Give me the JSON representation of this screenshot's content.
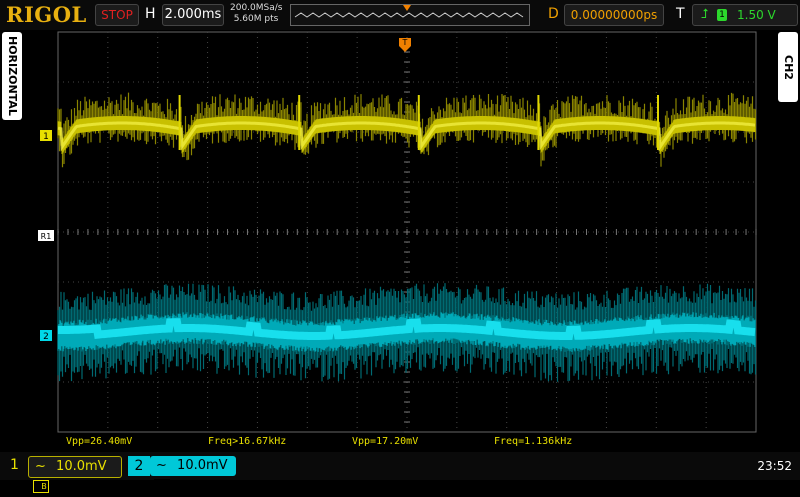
{
  "brand": "RIGOL",
  "run_state": "STOP",
  "timebase": {
    "label": "H",
    "value": "2.000ms"
  },
  "acquisition": {
    "sample_rate": "200.0MSa/s",
    "memory_depth": "5.60M pts"
  },
  "delay": {
    "label": "D",
    "value": "0.00000000ps"
  },
  "trigger": {
    "label": "T",
    "source": "1",
    "level": "1.50 V"
  },
  "side_tabs": {
    "left": "HORIZONTAL",
    "right": "CH2"
  },
  "markers": {
    "ch1": "1",
    "ch2": "2",
    "ref": "R1",
    "trigger_pos": "T"
  },
  "measurements": [
    {
      "text": "Vpp=26.40mV",
      "color": "#e8e000"
    },
    {
      "text": "Freq>16.67kHz",
      "color": "#e8e000"
    },
    {
      "text": "Vpp=17.20mV",
      "color": "#e8e000"
    },
    {
      "text": "Freq=1.136kHz",
      "color": "#e8e000"
    }
  ],
  "channels": [
    {
      "number": "1",
      "coupling": "~",
      "scale": "10.0mV",
      "color": "#e8e000"
    },
    {
      "number": "2",
      "coupling": "~",
      "scale": "10.0mV",
      "color": "#00d8e8"
    }
  ],
  "clock": "23:52",
  "colors": {
    "ch1": "#c8c000",
    "ch2": "#00e0f0",
    "trigger": "#f08000"
  }
}
